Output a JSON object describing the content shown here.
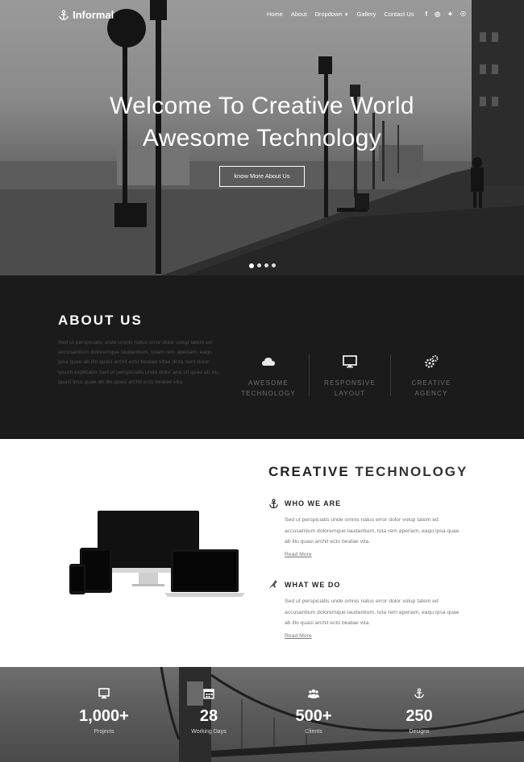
{
  "nav": {
    "brand": "Informal",
    "items": [
      {
        "label": "Home"
      },
      {
        "label": "About"
      },
      {
        "label": "Dropdown"
      },
      {
        "label": "Gallery"
      },
      {
        "label": "Contact Us"
      }
    ],
    "social": [
      "facebook-icon",
      "instagram-icon",
      "twitter-icon",
      "pinterest-icon"
    ]
  },
  "hero": {
    "title_line1": "Welcome To Creative World",
    "title_line2": "Awesome Technology",
    "button": "know More About Us",
    "slides": 4,
    "active_slide": 1
  },
  "about": {
    "heading_bold": "ABOUT",
    "heading_rest": " US",
    "paragraph": "Sed ut perspiciatis unde omnis natus error dolor volup tatem ed accusantium doloremque laudantium, totam rem aperiam, eaqu ipsa quae ab illo quasi archit ecto beatae vitae dicta sunt dolor ipsum explicabo Sed ut perspiciatis unde dolor and sit quae ab illo quasi ipsa quae ab illo quasi archit ecto beatae vita.",
    "features": [
      {
        "icon": "cloud-icon",
        "line1": "AWESOME",
        "line2": "TECHNOLOGY"
      },
      {
        "icon": "monitor-icon",
        "line1": "RESPONSIVE",
        "line2": "LAYOUT"
      },
      {
        "icon": "gears-icon",
        "line1": "CREATIVE",
        "line2": "AGENCY"
      }
    ]
  },
  "creative": {
    "heading_bold": "CREATIVE",
    "heading_rest": " TECHNOLOGY",
    "items": [
      {
        "icon": "anchor-icon",
        "title": "WHO WE ARE",
        "text": "Sed ut perspiciatis unde omnis natus error dolor volup tatem ed accusantium doloremque laudantium, tota rem aperiam, eaqu ipsa quae ab illo quasi archit ecto beatae vita.",
        "link": "Read More"
      },
      {
        "icon": "kangaroo-icon",
        "title": "WHAT WE DO",
        "text": "Sed ut perspiciatis unde omnis natus error dolor volup tatem ed accusantium doloremque laudantium, tota rem aperiam, eaqu ipsa quae ab illo quasi archit ecto beatae vita.",
        "link": "Read More"
      }
    ]
  },
  "stats": [
    {
      "icon": "monitor-icon",
      "value": "1,000+",
      "label": "Projects"
    },
    {
      "icon": "calendar-icon",
      "value": "28",
      "label": "Working Days"
    },
    {
      "icon": "users-icon",
      "value": "500+",
      "label": "Clients"
    },
    {
      "icon": "anchor-icon",
      "value": "250",
      "label": "Designs"
    }
  ]
}
